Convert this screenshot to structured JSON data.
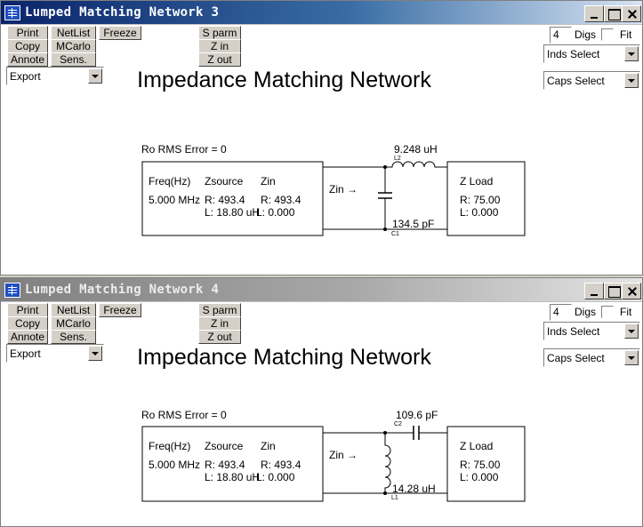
{
  "windows": [
    {
      "title": "Lumped Matching Network 3",
      "active": true,
      "toolbar": {
        "print": "Print",
        "netlist": "NetList",
        "freeze": "Freeze",
        "s_parm": "S parm",
        "copy": "Copy",
        "mcarlo": "MCarlo",
        "z_in": "Z in",
        "annote": "Annote",
        "sens": "Sens.",
        "z_out": "Z out"
      },
      "digs": {
        "value": "4",
        "label": "Digs",
        "fit_label": "Fit",
        "fit_checked": false
      },
      "export_select": "Export",
      "inds_select": "Inds Select",
      "caps_select": "Caps Select",
      "heading": "Impedance Matching Network",
      "error_text": "Ro RMS Error = 0",
      "source_box": {
        "freq_header": "Freq(Hz)",
        "zsource_header": "Zsource",
        "zin_header": "Zin",
        "freq": "5.000 MHz",
        "zs_r": "R: 493.4",
        "zin_r": "R: 493.4",
        "zs_l": "L: 18.80 uH",
        "zin_l": "L: 0.000"
      },
      "zin_arrow_label": "Zin →",
      "load_box": {
        "title": "Z Load",
        "r": "R: 75.00",
        "l": "L: 0.000"
      },
      "series": {
        "value": "9.248 uH",
        "ref": "L2"
      },
      "shunt": {
        "value": "134.5 pF",
        "ref": "C1"
      }
    },
    {
      "title": "Lumped Matching Network 4",
      "active": false,
      "toolbar": {
        "print": "Print",
        "netlist": "NetList",
        "freeze": "Freeze",
        "s_parm": "S parm",
        "copy": "Copy",
        "mcarlo": "MCarlo",
        "z_in": "Z in",
        "annote": "Annote",
        "sens": "Sens.",
        "z_out": "Z out"
      },
      "digs": {
        "value": "4",
        "label": "Digs",
        "fit_label": "Fit",
        "fit_checked": false
      },
      "export_select": "Export",
      "inds_select": "Inds Select",
      "caps_select": "Caps Select",
      "heading": "Impedance Matching Network",
      "error_text": "Ro RMS Error = 0",
      "source_box": {
        "freq_header": "Freq(Hz)",
        "zsource_header": "Zsource",
        "zin_header": "Zin",
        "freq": "5.000 MHz",
        "zs_r": "R: 493.4",
        "zin_r": "R: 493.4",
        "zs_l": "L: 18.80 uH",
        "zin_l": "L: 0.000"
      },
      "zin_arrow_label": "Zin →",
      "load_box": {
        "title": "Z Load",
        "r": "R: 75.00",
        "l": "L: 0.000"
      },
      "series": {
        "value": "109.6 pF",
        "ref": "C2"
      },
      "shunt": {
        "value": "14.28 uH",
        "ref": "L1"
      }
    }
  ]
}
